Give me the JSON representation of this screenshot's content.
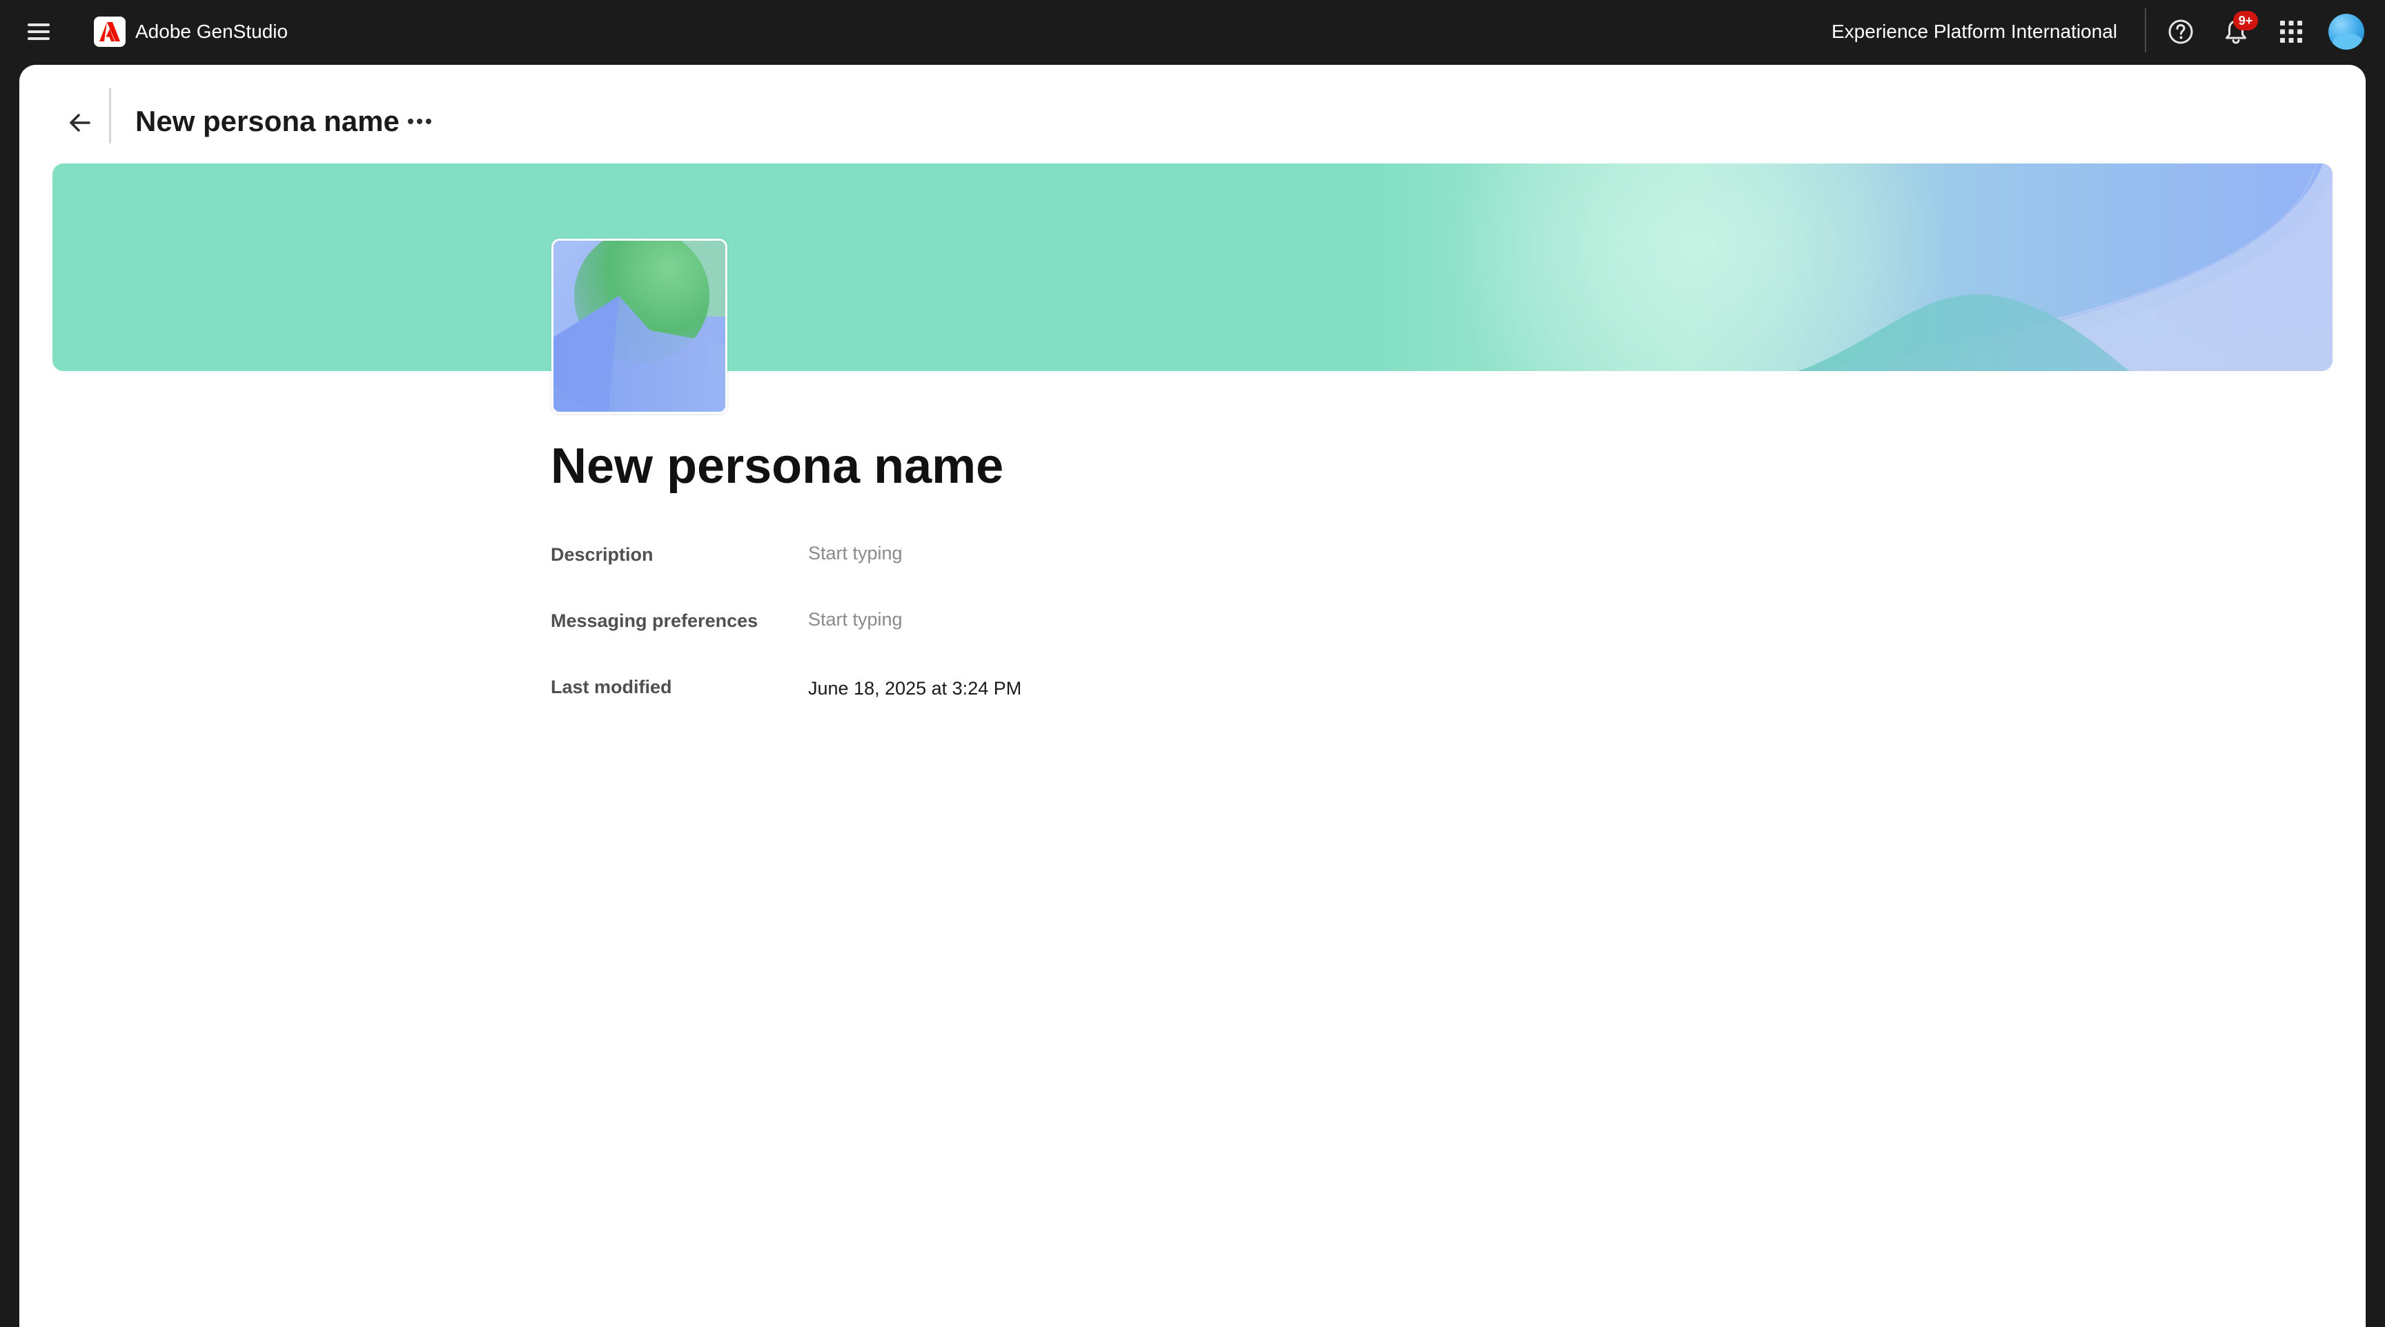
{
  "appbar": {
    "brand_name": "Adobe GenStudio",
    "org_name": "Experience Platform International",
    "notification_badge": "9+",
    "icons": [
      "menu-icon",
      "adobe-logo-icon",
      "help-icon",
      "bell-icon",
      "app-grid-icon",
      "avatar"
    ]
  },
  "header": {
    "title": "New persona name"
  },
  "persona": {
    "name": "New persona name",
    "fields": [
      {
        "label": "Description",
        "placeholder": "Start typing"
      },
      {
        "label": "Messaging preferences",
        "placeholder": "Start typing"
      },
      {
        "label": "Last modified",
        "value": "June 18, 2025 at 3:24 PM"
      }
    ]
  },
  "colors": {
    "appbar_bg": "#1b1b1b",
    "banner_green": "#82dfc4",
    "banner_blue": "#93b2f6",
    "notification_red": "#d31510"
  }
}
